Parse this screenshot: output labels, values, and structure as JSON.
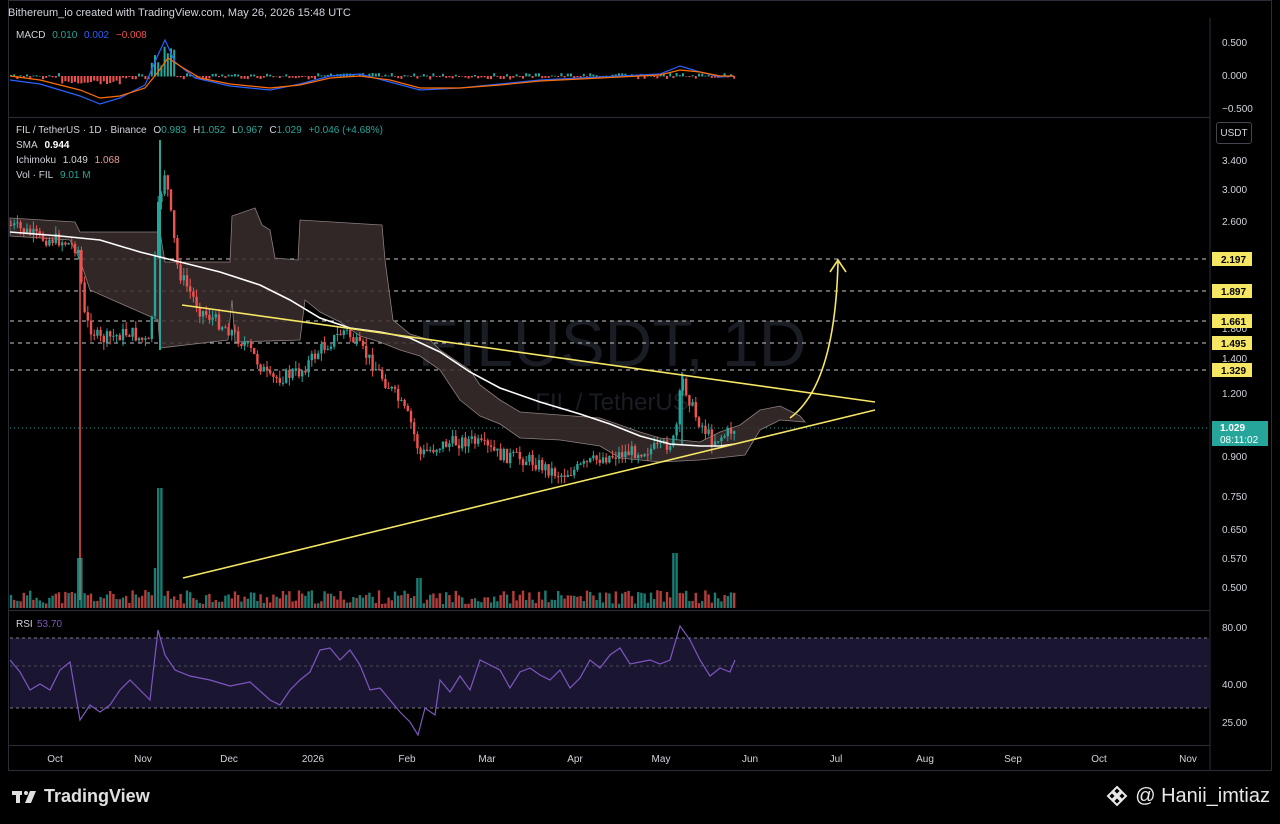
{
  "header": {
    "text": "Bithereum_io created with TradingView.com, May 26, 2026 15:48 UTC"
  },
  "macd": {
    "label": "MACD",
    "v1": "0.010",
    "v2": "0.002",
    "v3": "−0.008",
    "axis": [
      "0.500",
      "0.000",
      "−0.500"
    ]
  },
  "main_legend": {
    "symbol": "FIL / TetherUS · 1D · Binance",
    "o_label": "O",
    "o": "0.983",
    "h_label": "H",
    "h": "1.052",
    "l_label": "L",
    "l": "0.967",
    "c_label": "C",
    "c": "1.029",
    "change": "+0.046 (+4.68%)",
    "sma_label": "SMA",
    "sma": "0.944",
    "ichimoku_label": "Ichimoku",
    "ichimoku_1": "1.049",
    "ichimoku_2": "1.068",
    "vol_label": "Vol · FIL",
    "vol": "9.01 M"
  },
  "currency_button": "USDT",
  "price_axis": [
    "3.400",
    "3.000",
    "2.600",
    "1.800",
    "1.400",
    "1.200",
    "0.900",
    "0.750",
    "0.650",
    "0.570",
    "0.500"
  ],
  "levels": [
    {
      "label": "2.197",
      "color": "#f5e663"
    },
    {
      "label": "1.897",
      "color": "#f5e663"
    },
    {
      "label": "1.661",
      "color": "#f5e663"
    },
    {
      "label": "1.495",
      "color": "#f5e663"
    },
    {
      "label": "1.329",
      "color": "#f5e663"
    }
  ],
  "last_price": {
    "value": "1.029",
    "countdown": "08:11:02",
    "color": "#26a69a"
  },
  "watermark": {
    "big": "FILUSDT, 1D",
    "small": "FIL / TetherUS"
  },
  "rsi": {
    "label": "RSI",
    "value": "53.70",
    "axis": [
      "80.00",
      "40.00",
      "25.00"
    ]
  },
  "time_axis": [
    "Oct",
    "Nov",
    "Dec",
    "2026",
    "Feb",
    "Mar",
    "Apr",
    "May",
    "Jun",
    "Jul",
    "Aug",
    "Sep",
    "Oct",
    "Nov"
  ],
  "brand": "TradingView",
  "credit": "@ Hanii_imtiaz",
  "chart_data": {
    "type": "candlestick",
    "title": "FIL / TetherUS · 1D · Binance",
    "x": [
      "Oct",
      "Nov",
      "Dec",
      "2026",
      "Feb",
      "Mar",
      "Apr",
      "May",
      "Jun"
    ],
    "close_approx": [
      2.5,
      1.45,
      1.55,
      1.5,
      1.0,
      0.95,
      0.85,
      1.15,
      1.029
    ],
    "ylim": [
      0.45,
      3.8
    ],
    "scale": "log",
    "resistance_levels": [
      2.197,
      1.897,
      1.661,
      1.495,
      1.329
    ],
    "colors": {
      "up": "#26a69a",
      "down": "#ef5350",
      "sma": "#ffffff",
      "trendline": "#f5e663",
      "rsi": "#7e57c2"
    }
  }
}
